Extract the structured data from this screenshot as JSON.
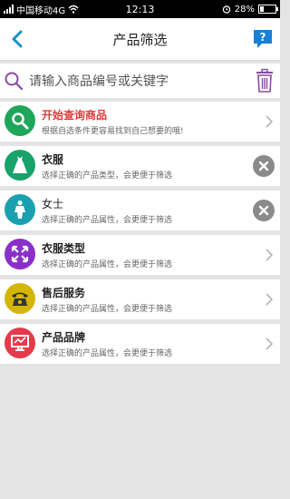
{
  "status": {
    "carrier": "中国移动4G",
    "time": "12:13",
    "battery": "28%"
  },
  "nav": {
    "title": "产品筛选"
  },
  "search": {
    "placeholder": "请输入商品编号或关键字"
  },
  "items": [
    {
      "title": "开始查询商品",
      "subtitle": "根据自选条件更容易找到自己想要的哦!",
      "color": "#1fa65a",
      "icon": "search-icon",
      "action": "chevron"
    },
    {
      "title": "衣服",
      "subtitle": "选择正确的产品类型，会更便于筛选",
      "color": "#17a36a",
      "icon": "dress-icon",
      "action": "remove"
    },
    {
      "title": "女士",
      "subtitle": "选择正确的产品属性，会更便于筛选",
      "color": "#1aa0b0",
      "icon": "person-icon",
      "action": "remove"
    },
    {
      "title": "衣服类型",
      "subtitle": "选择正确的产品属性，会更便于筛选",
      "color": "#8a2fc9",
      "icon": "expand-icon",
      "action": "chevron"
    },
    {
      "title": "售后服务",
      "subtitle": "选择正确的产品属性，会更便于筛选",
      "color": "#d4b500",
      "icon": "phone-icon",
      "action": "chevron"
    },
    {
      "title": "产品品牌",
      "subtitle": "选择正确的产品属性，会更便于筛选",
      "color": "#e53a4a",
      "icon": "monitor-icon",
      "action": "chevron"
    }
  ],
  "colors": {
    "accent": "#1a8fc8",
    "background": "#e4e4e4"
  }
}
